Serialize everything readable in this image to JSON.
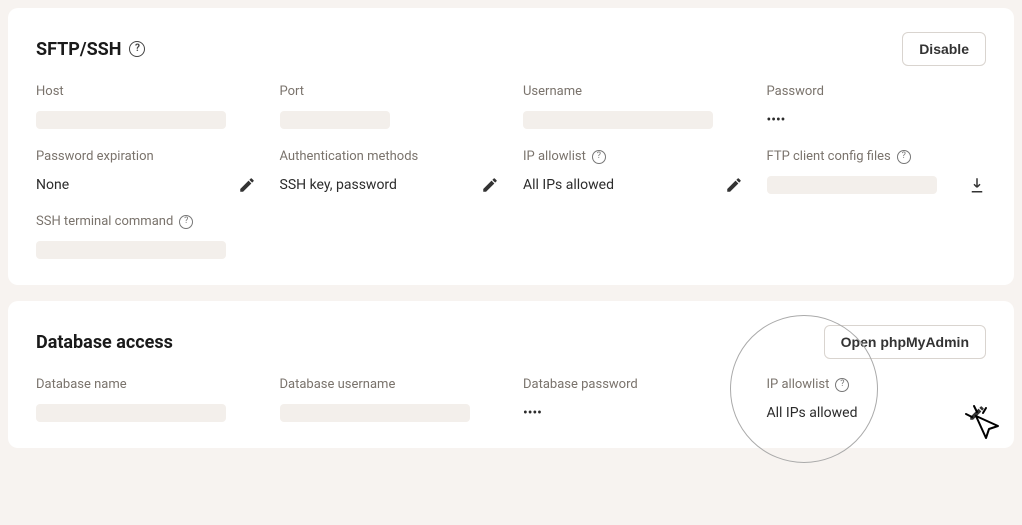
{
  "sftp": {
    "title": "SFTP/SSH",
    "disable_label": "Disable",
    "fields": {
      "host_label": "Host",
      "port_label": "Port",
      "username_label": "Username",
      "password_label": "Password",
      "password_value": "••••",
      "expiration_label": "Password expiration",
      "expiration_value": "None",
      "auth_label": "Authentication methods",
      "auth_value": "SSH key, password",
      "allowlist_label": "IP allowlist",
      "allowlist_value": "All IPs allowed",
      "ftp_config_label": "FTP client config files",
      "ssh_cmd_label": "SSH terminal command"
    }
  },
  "db": {
    "title": "Database access",
    "open_label": "Open phpMyAdmin",
    "fields": {
      "name_label": "Database name",
      "user_label": "Database username",
      "password_label": "Database password",
      "password_value": "••••",
      "allowlist_label": "IP allowlist",
      "allowlist_value": "All IPs allowed"
    }
  }
}
